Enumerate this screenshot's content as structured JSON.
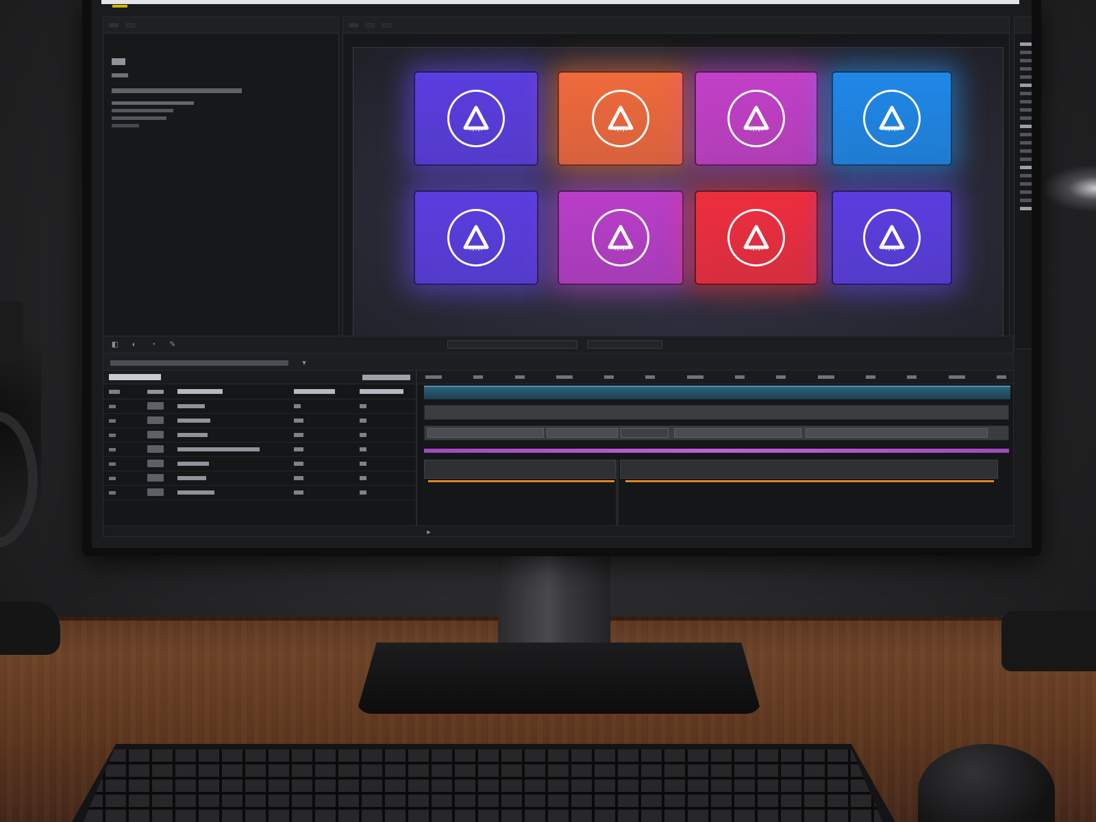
{
  "viewer": {
    "tiles": [
      {
        "color": "#5a3ee0",
        "glow": "#6b4cff"
      },
      {
        "color": "#f06a3c",
        "glow": "#ff7a30"
      },
      {
        "color": "#c340c8",
        "glow": "#d04ad8"
      },
      {
        "color": "#1f88e8",
        "glow": "#2a9bff"
      },
      {
        "color": "#5a3ee0",
        "glow": "#6b4cff"
      },
      {
        "color": "#b83ec8",
        "glow": "#c24bd8"
      },
      {
        "color": "#ee2e3e",
        "glow": "#ff3440"
      },
      {
        "color": "#5a3ee0",
        "glow": "#6b4cff"
      }
    ],
    "tile_icon": "triangle-logo-icon"
  },
  "theme": {
    "panel_bg": "#17181a",
    "work_area": "#2f5f78",
    "purple_track": "#c060d8",
    "orange_track": "#e08a20"
  },
  "icons": {
    "toolbar": [
      "selection-tool-icon",
      "hand-tool-icon",
      "zoom-tool-icon",
      "pen-tool-icon"
    ],
    "timeline": [
      "playhead-icon",
      "marker-icon"
    ]
  }
}
